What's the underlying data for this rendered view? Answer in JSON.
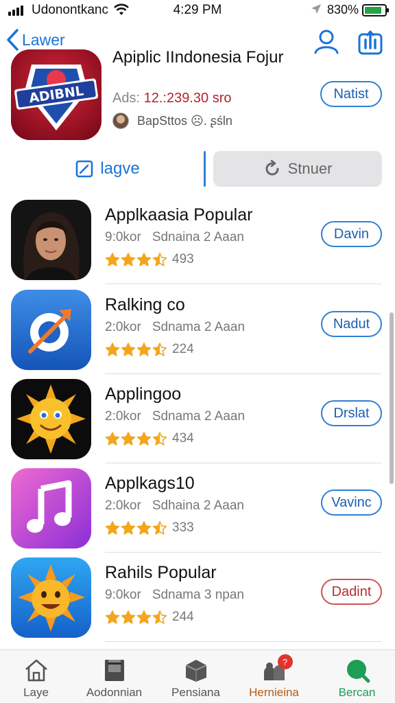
{
  "status": {
    "carrier": "Udonontkanc",
    "time": "4:29 PM",
    "battery": "830%",
    "battery_fill": 0.85,
    "battery_color": "#22a447"
  },
  "nav": {
    "back_label": "Lawer",
    "icons": [
      "person-icon",
      "share-icon"
    ]
  },
  "featured": {
    "icon_text": "ADIBNL",
    "title": "Apiplic IIndonesia Fojur",
    "price_label": "Ads:",
    "price_value": "12.:239.30",
    "price_suffix": "sro",
    "developer": "BapSttos ☹. ʂśln",
    "button": "Natist"
  },
  "segment": {
    "left_label": "lagve",
    "right_label": "Stnuer"
  },
  "apps": [
    {
      "name": "Applkaasia Popular",
      "size": "9:0kor",
      "category": "Sdnaina 2 Aaan",
      "rating": 3.5,
      "count": "493",
      "button": "Davin",
      "button_style": "blue"
    },
    {
      "name": "Ralking co",
      "size": "2:0kor",
      "category": "Sdnama 2 Aaan",
      "rating": 3.5,
      "count": "224",
      "button": "Nadut",
      "button_style": "blue"
    },
    {
      "name": "Applingoo",
      "size": "2:0kor",
      "category": "Sdnama 2 Aaan",
      "rating": 3.5,
      "count": "434",
      "button": "Drslat",
      "button_style": "blue"
    },
    {
      "name": "Applkags10",
      "size": "2:0kor",
      "category": "Sdhaina 2 Aaan",
      "rating": 3.5,
      "count": "333",
      "button": "Vavinc",
      "button_style": "blue"
    },
    {
      "name": "Rahils Popular",
      "size": "9:0kor",
      "category": "Sdnama 3 npan",
      "rating": 3.5,
      "count": "244",
      "button": "Dadint",
      "button_style": "red"
    }
  ],
  "tabs": [
    {
      "label": "Laye",
      "icon": "home-icon"
    },
    {
      "label": "Aodonnian",
      "icon": "book-icon"
    },
    {
      "label": "Pensiana",
      "icon": "box-icon"
    },
    {
      "label": "Hernieina",
      "icon": "people-icon",
      "badge": "?"
    },
    {
      "label": "Bercan",
      "icon": "search-icon"
    }
  ],
  "colors": {
    "accent": "#1a73d8",
    "star": "#f3a61d",
    "price": "#b3232e",
    "active_tab": "#b85a12",
    "green_tab": "#1e9d55"
  }
}
